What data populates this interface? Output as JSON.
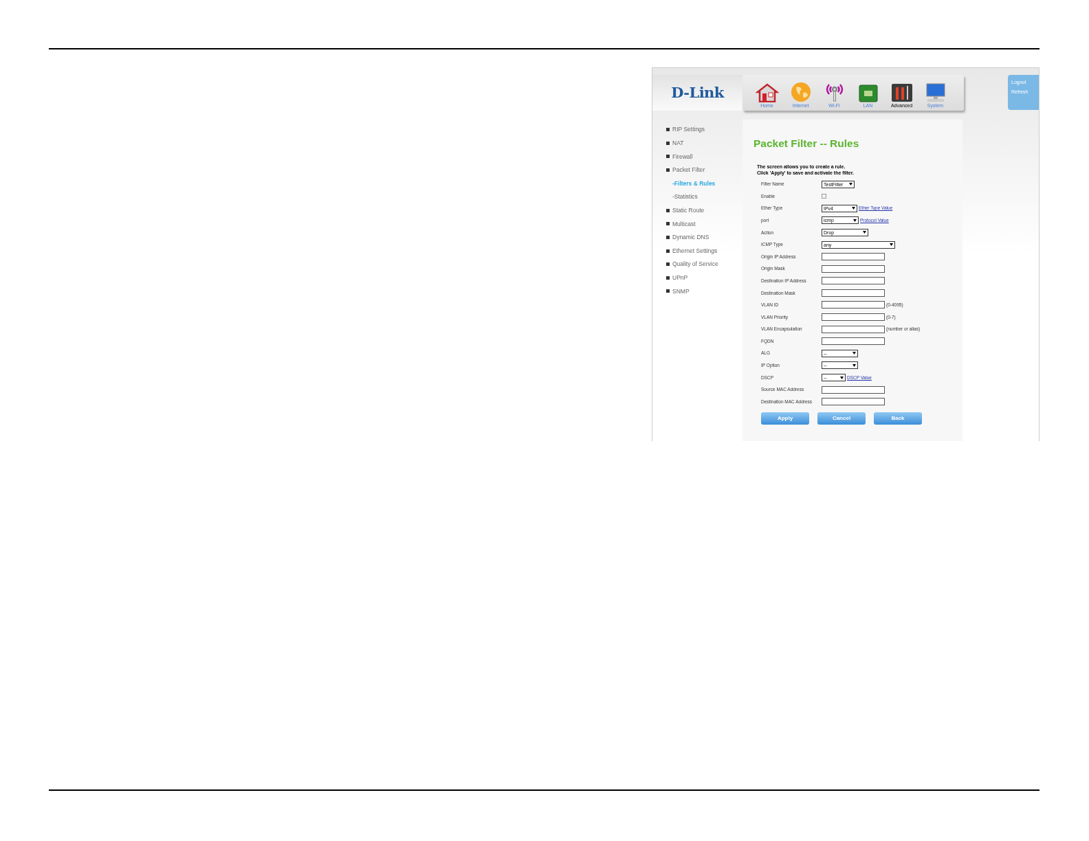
{
  "header": {
    "logo": "D-Link",
    "nav": [
      {
        "label": "Home",
        "selected": false
      },
      {
        "label": "Internet",
        "selected": false
      },
      {
        "label": "Wi-Fi",
        "selected": false
      },
      {
        "label": "LAN",
        "selected": false
      },
      {
        "label": "Advanced",
        "selected": true
      },
      {
        "label": "System",
        "selected": false
      }
    ],
    "account_links": [
      "Logout",
      "Refresh"
    ]
  },
  "sidebar": {
    "items": [
      {
        "label": "RIP Settings",
        "selected": false
      },
      {
        "label": "NAT",
        "selected": false
      },
      {
        "label": "Firewall",
        "selected": false
      },
      {
        "label": "Packet Filter",
        "selected": false,
        "children": [
          {
            "label": "-Filters & Rules",
            "selected": true
          },
          {
            "label": "-Statistics",
            "selected": false
          }
        ]
      },
      {
        "label": "Static Route",
        "selected": false
      },
      {
        "label": "Multicast",
        "selected": false
      },
      {
        "label": "Dynamic DNS",
        "selected": false
      },
      {
        "label": "Ethernet Settings",
        "selected": false
      },
      {
        "label": "Quality of Service",
        "selected": false
      },
      {
        "label": "UPnP",
        "selected": false
      },
      {
        "label": "SNMP",
        "selected": false
      }
    ]
  },
  "content": {
    "title": "Packet Filter -- Rules",
    "intro": [
      "The screen allows you to create a rule.",
      "Click 'Apply' to save and activate the filter."
    ],
    "fields": [
      {
        "label": "Filter Name",
        "kind": "select",
        "value": "TestFilter"
      },
      {
        "label": "Enable",
        "kind": "checkbox",
        "checked": false
      },
      {
        "label": "Ether Type",
        "kind": "select",
        "value": "IPv4",
        "link": "Ether Type Value"
      },
      {
        "label": "port",
        "kind": "select",
        "value": "icmp",
        "link": "Protocol Value"
      },
      {
        "label": "Action",
        "kind": "select",
        "value": "Drop"
      },
      {
        "label": "ICMP Type",
        "kind": "select",
        "value": "any"
      },
      {
        "label": "Origin IP Address",
        "kind": "text"
      },
      {
        "label": "Origin Mask",
        "kind": "text"
      },
      {
        "label": "Destination IP Address",
        "kind": "text"
      },
      {
        "label": "Destination Mask",
        "kind": "text"
      },
      {
        "label": "VLAN ID",
        "kind": "text",
        "hint": "(0-4095)"
      },
      {
        "label": "VLAN Priority",
        "kind": "text",
        "hint": "(0-7)"
      },
      {
        "label": "VLAN Encapsulation",
        "kind": "text",
        "hint": "(number or alias)"
      },
      {
        "label": "FQDN",
        "kind": "text"
      },
      {
        "label": "ALG",
        "kind": "select",
        "value": "--"
      },
      {
        "label": "IP Option",
        "kind": "select",
        "value": "--"
      },
      {
        "label": "DSCP",
        "kind": "select",
        "value": "--",
        "link": "DSCP Value"
      },
      {
        "label": "Source MAC Address",
        "kind": "text"
      },
      {
        "label": "Destination MAC Address",
        "kind": "text"
      }
    ],
    "buttons": [
      "Apply",
      "Cancel",
      "Back"
    ]
  }
}
